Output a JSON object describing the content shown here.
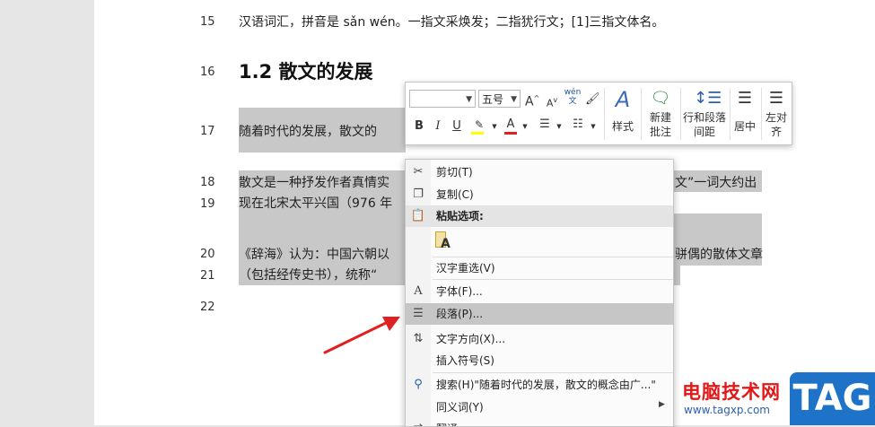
{
  "document": {
    "line_numbers": [
      "15",
      "16",
      "17",
      "18",
      "19",
      "20",
      "21",
      "22"
    ],
    "line15": "汉语词汇，拼音是 sǎn wén。一指文采焕发；二指犹行文；[1]三指文体名。",
    "heading": "1.2 散文的发展",
    "line17": "随着时代的发展，散文的",
    "line18_left": "散文是一种抒发作者真情实",
    "line18_right": "文”一词大约出",
    "line19": "现在北宋太平兴国（976 年",
    "line20_left": "《辞海》认为：中国六朝以",
    "line20_right": "骈偶的散体文章",
    "line21": "（包括经传史书），统称“"
  },
  "mini_toolbar": {
    "font_name": "",
    "font_size": "五号",
    "grow_font": "A",
    "shrink_font": "A",
    "phonetic": "wén文",
    "bold": "B",
    "italic": "I",
    "underline": "U",
    "font_color": "A",
    "styles_label": "样式",
    "new_comment_label_1": "新建",
    "new_comment_label_2": "批注",
    "line_spacing_label_1": "行和段落",
    "line_spacing_label_2": "间距",
    "center_label": "居中",
    "align_left_label_1": "左对",
    "align_left_label_2": "齐"
  },
  "context_menu": {
    "cut": "剪切(T)",
    "copy": "复制(C)",
    "paste_options": "粘贴选项:",
    "hanzi_reconvert": "汉字重选(V)",
    "font": "字体(F)...",
    "paragraph": "段落(P)...",
    "text_direction": "文字方向(X)...",
    "insert_symbol": "插入符号(S)",
    "search": "搜索(H)\"随着时代的发展，散文的概念由广...\"",
    "synonyms": "同义词(Y)",
    "translate": "翻译"
  },
  "watermark": {
    "site_name": "电脑技术网",
    "url": "www.tagxp.com",
    "tag": "TAG"
  },
  "colors": {
    "selection": "#c8c8c8",
    "highlight_yellow": "#ffff00",
    "font_color_red": "#e02020",
    "arrow_red": "#e02020",
    "tag_blue": "#1e73c8"
  }
}
